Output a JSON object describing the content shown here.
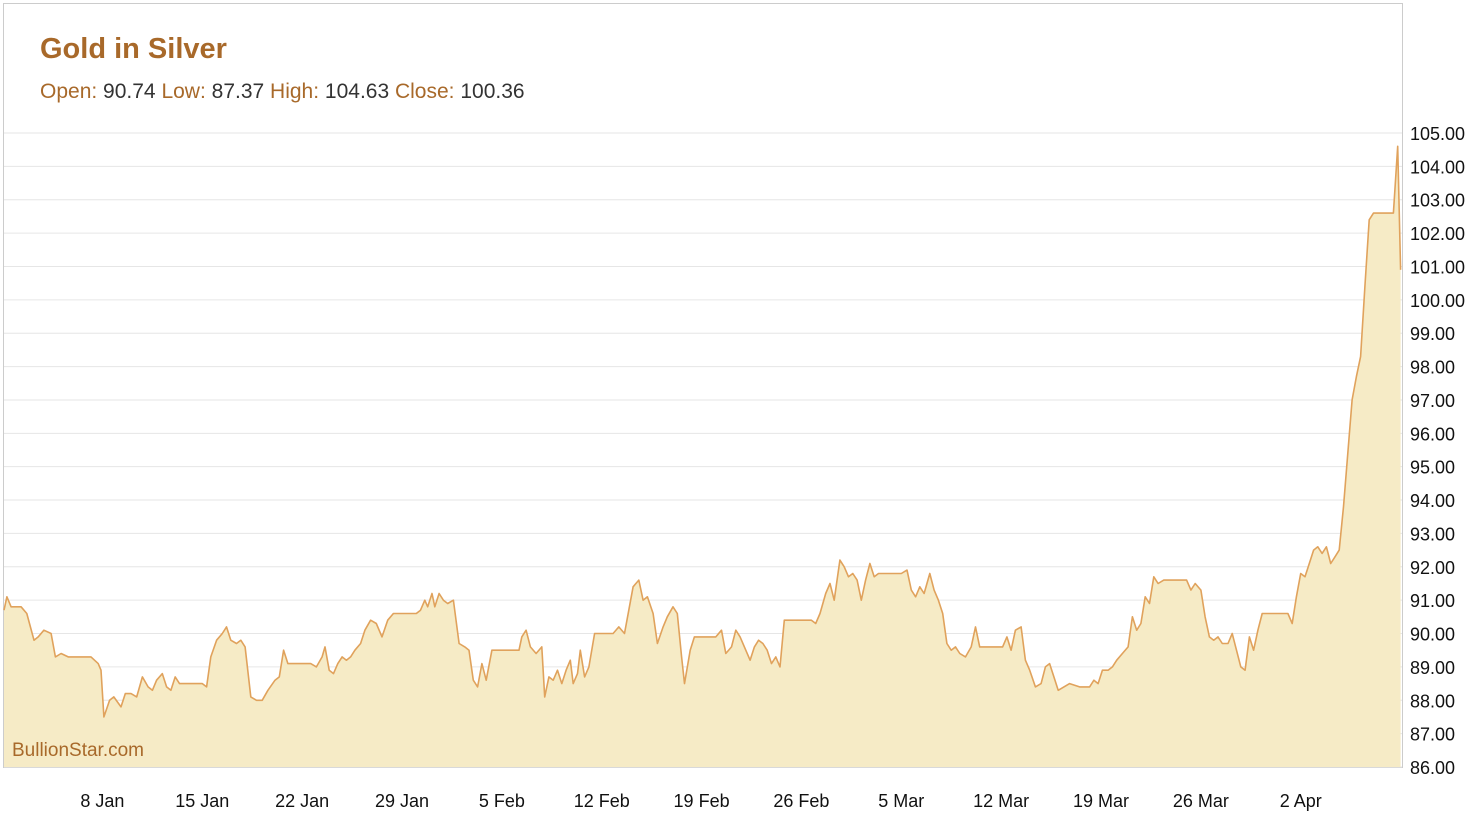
{
  "colors": {
    "accent": "#a8692a",
    "value_text": "#333333",
    "line": "#e0a25c",
    "fill": "#f6ebc6",
    "grid": "#e6e6e6",
    "border": "#cccccc"
  },
  "chart_data": {
    "type": "area",
    "title": "Gold in Silver",
    "stats": [
      {
        "label": "Open:",
        "value": "90.74"
      },
      {
        "label": "Low:",
        "value": "87.37"
      },
      {
        "label": "High:",
        "value": "104.63"
      },
      {
        "label": "Close:",
        "value": "100.36"
      }
    ],
    "watermark": "BullionStar.com",
    "ylim": [
      86,
      105
    ],
    "y_ticks": [
      "105.00",
      "104.00",
      "103.00",
      "102.00",
      "101.00",
      "100.00",
      "99.00",
      "98.00",
      "97.00",
      "96.00",
      "95.00",
      "94.00",
      "93.00",
      "92.00",
      "91.00",
      "90.00",
      "89.00",
      "88.00",
      "87.00",
      "86.00"
    ],
    "x_ticks": [
      {
        "label": "8 Jan",
        "day": 8
      },
      {
        "label": "15 Jan",
        "day": 15
      },
      {
        "label": "22 Jan",
        "day": 22
      },
      {
        "label": "29 Jan",
        "day": 29
      },
      {
        "label": "5 Feb",
        "day": 36
      },
      {
        "label": "12 Feb",
        "day": 43
      },
      {
        "label": "19 Feb",
        "day": 50
      },
      {
        "label": "26 Feb",
        "day": 57
      },
      {
        "label": "5 Mar",
        "day": 64
      },
      {
        "label": "12 Mar",
        "day": 71
      },
      {
        "label": "19 Mar",
        "day": 78
      },
      {
        "label": "26 Mar",
        "day": 85
      },
      {
        "label": "2 Apr",
        "day": 92
      }
    ],
    "xlim": [
      1.1,
      99.1
    ],
    "series": [
      {
        "points": [
          [
            1.1,
            90.7
          ],
          [
            1.3,
            91.1
          ],
          [
            1.6,
            90.8
          ],
          [
            2.3,
            90.8
          ],
          [
            2.7,
            90.6
          ],
          [
            3.2,
            89.8
          ],
          [
            3.5,
            89.9
          ],
          [
            3.9,
            90.1
          ],
          [
            4.4,
            90.0
          ],
          [
            4.7,
            89.3
          ],
          [
            5.1,
            89.4
          ],
          [
            5.6,
            89.3
          ],
          [
            6.5,
            89.3
          ],
          [
            7.2,
            89.3
          ],
          [
            7.7,
            89.1
          ],
          [
            7.9,
            88.9
          ],
          [
            8.1,
            87.5
          ],
          [
            8.5,
            88.0
          ],
          [
            8.8,
            88.1
          ],
          [
            9.3,
            87.8
          ],
          [
            9.6,
            88.2
          ],
          [
            10.0,
            88.2
          ],
          [
            10.4,
            88.1
          ],
          [
            10.8,
            88.7
          ],
          [
            11.2,
            88.4
          ],
          [
            11.5,
            88.3
          ],
          [
            11.8,
            88.6
          ],
          [
            12.2,
            88.8
          ],
          [
            12.5,
            88.4
          ],
          [
            12.8,
            88.3
          ],
          [
            13.1,
            88.7
          ],
          [
            13.4,
            88.5
          ],
          [
            14.2,
            88.5
          ],
          [
            15.0,
            88.5
          ],
          [
            15.3,
            88.4
          ],
          [
            15.6,
            89.3
          ],
          [
            16.0,
            89.8
          ],
          [
            16.4,
            90.0
          ],
          [
            16.7,
            90.2
          ],
          [
            17.0,
            89.8
          ],
          [
            17.4,
            89.7
          ],
          [
            17.7,
            89.8
          ],
          [
            18.0,
            89.6
          ],
          [
            18.4,
            88.1
          ],
          [
            18.8,
            88.0
          ],
          [
            19.2,
            88.0
          ],
          [
            19.6,
            88.3
          ],
          [
            20.1,
            88.6
          ],
          [
            20.4,
            88.7
          ],
          [
            20.7,
            89.5
          ],
          [
            21.0,
            89.1
          ],
          [
            21.3,
            89.1
          ],
          [
            22.3,
            89.1
          ],
          [
            22.6,
            89.1
          ],
          [
            23.0,
            89.0
          ],
          [
            23.4,
            89.3
          ],
          [
            23.6,
            89.6
          ],
          [
            23.9,
            88.9
          ],
          [
            24.2,
            88.8
          ],
          [
            24.5,
            89.1
          ],
          [
            24.8,
            89.3
          ],
          [
            25.1,
            89.2
          ],
          [
            25.4,
            89.3
          ],
          [
            25.7,
            89.5
          ],
          [
            26.1,
            89.7
          ],
          [
            26.4,
            90.1
          ],
          [
            26.8,
            90.4
          ],
          [
            27.2,
            90.3
          ],
          [
            27.6,
            89.9
          ],
          [
            28.0,
            90.4
          ],
          [
            28.4,
            90.6
          ],
          [
            29.3,
            90.6
          ],
          [
            30.0,
            90.6
          ],
          [
            30.3,
            90.7
          ],
          [
            30.6,
            91.0
          ],
          [
            30.8,
            90.8
          ],
          [
            31.1,
            91.2
          ],
          [
            31.3,
            90.8
          ],
          [
            31.6,
            91.2
          ],
          [
            31.9,
            91.0
          ],
          [
            32.2,
            90.9
          ],
          [
            32.6,
            91.0
          ],
          [
            33.0,
            89.7
          ],
          [
            33.4,
            89.6
          ],
          [
            33.7,
            89.5
          ],
          [
            34.0,
            88.6
          ],
          [
            34.3,
            88.4
          ],
          [
            34.6,
            89.1
          ],
          [
            34.9,
            88.6
          ],
          [
            35.3,
            89.5
          ],
          [
            36.0,
            89.5
          ],
          [
            36.8,
            89.5
          ],
          [
            37.2,
            89.5
          ],
          [
            37.4,
            89.9
          ],
          [
            37.7,
            90.1
          ],
          [
            38.0,
            89.6
          ],
          [
            38.4,
            89.4
          ],
          [
            38.8,
            89.6
          ],
          [
            39.0,
            88.1
          ],
          [
            39.3,
            88.7
          ],
          [
            39.6,
            88.6
          ],
          [
            39.9,
            88.9
          ],
          [
            40.2,
            88.5
          ],
          [
            40.5,
            88.9
          ],
          [
            40.8,
            89.2
          ],
          [
            41.0,
            88.5
          ],
          [
            41.3,
            88.8
          ],
          [
            41.5,
            89.5
          ],
          [
            41.8,
            88.7
          ],
          [
            42.1,
            89.0
          ],
          [
            42.5,
            90.0
          ],
          [
            43.0,
            90.0
          ],
          [
            43.8,
            90.0
          ],
          [
            44.2,
            90.2
          ],
          [
            44.6,
            90.0
          ],
          [
            44.9,
            90.7
          ],
          [
            45.2,
            91.4
          ],
          [
            45.6,
            91.6
          ],
          [
            45.9,
            91.0
          ],
          [
            46.2,
            91.1
          ],
          [
            46.6,
            90.6
          ],
          [
            46.9,
            89.7
          ],
          [
            47.3,
            90.2
          ],
          [
            47.6,
            90.5
          ],
          [
            48.0,
            90.8
          ],
          [
            48.3,
            90.6
          ],
          [
            48.6,
            89.3
          ],
          [
            48.8,
            88.5
          ],
          [
            49.2,
            89.5
          ],
          [
            49.5,
            89.9
          ],
          [
            50.3,
            89.9
          ],
          [
            51.0,
            89.9
          ],
          [
            51.4,
            90.1
          ],
          [
            51.7,
            89.4
          ],
          [
            52.1,
            89.6
          ],
          [
            52.4,
            90.1
          ],
          [
            52.7,
            89.9
          ],
          [
            53.0,
            89.6
          ],
          [
            53.4,
            89.2
          ],
          [
            53.7,
            89.6
          ],
          [
            54.0,
            89.8
          ],
          [
            54.3,
            89.7
          ],
          [
            54.6,
            89.5
          ],
          [
            54.9,
            89.1
          ],
          [
            55.2,
            89.3
          ],
          [
            55.5,
            89.0
          ],
          [
            55.8,
            90.4
          ],
          [
            56.2,
            90.4
          ],
          [
            57.0,
            90.4
          ],
          [
            57.7,
            90.4
          ],
          [
            58.0,
            90.3
          ],
          [
            58.3,
            90.6
          ],
          [
            58.7,
            91.2
          ],
          [
            59.0,
            91.5
          ],
          [
            59.3,
            91.0
          ],
          [
            59.7,
            92.2
          ],
          [
            60.0,
            92.0
          ],
          [
            60.3,
            91.7
          ],
          [
            60.6,
            91.8
          ],
          [
            60.9,
            91.6
          ],
          [
            61.2,
            91.0
          ],
          [
            61.5,
            91.6
          ],
          [
            61.8,
            92.1
          ],
          [
            62.1,
            91.7
          ],
          [
            62.4,
            91.8
          ],
          [
            63.2,
            91.8
          ],
          [
            64.0,
            91.8
          ],
          [
            64.4,
            91.9
          ],
          [
            64.7,
            91.3
          ],
          [
            65.0,
            91.1
          ],
          [
            65.3,
            91.4
          ],
          [
            65.6,
            91.2
          ],
          [
            66.0,
            91.8
          ],
          [
            66.3,
            91.3
          ],
          [
            66.6,
            91.0
          ],
          [
            66.9,
            90.6
          ],
          [
            67.2,
            89.7
          ],
          [
            67.5,
            89.5
          ],
          [
            67.8,
            89.6
          ],
          [
            68.1,
            89.4
          ],
          [
            68.5,
            89.3
          ],
          [
            68.9,
            89.6
          ],
          [
            69.2,
            90.2
          ],
          [
            69.5,
            89.6
          ],
          [
            70.3,
            89.6
          ],
          [
            71.1,
            89.6
          ],
          [
            71.4,
            89.9
          ],
          [
            71.7,
            89.5
          ],
          [
            72.0,
            90.1
          ],
          [
            72.4,
            90.2
          ],
          [
            72.7,
            89.2
          ],
          [
            73.0,
            88.9
          ],
          [
            73.4,
            88.4
          ],
          [
            73.8,
            88.5
          ],
          [
            74.1,
            89.0
          ],
          [
            74.4,
            89.1
          ],
          [
            74.7,
            88.7
          ],
          [
            75.0,
            88.3
          ],
          [
            75.4,
            88.4
          ],
          [
            75.8,
            88.5
          ],
          [
            76.5,
            88.4
          ],
          [
            77.2,
            88.4
          ],
          [
            77.5,
            88.6
          ],
          [
            77.8,
            88.5
          ],
          [
            78.1,
            88.9
          ],
          [
            78.5,
            88.9
          ],
          [
            78.8,
            89.0
          ],
          [
            79.1,
            89.2
          ],
          [
            79.5,
            89.4
          ],
          [
            79.9,
            89.6
          ],
          [
            80.2,
            90.5
          ],
          [
            80.5,
            90.1
          ],
          [
            80.8,
            90.3
          ],
          [
            81.1,
            91.1
          ],
          [
            81.4,
            90.9
          ],
          [
            81.7,
            91.7
          ],
          [
            82.0,
            91.5
          ],
          [
            82.4,
            91.6
          ],
          [
            83.0,
            91.6
          ],
          [
            83.7,
            91.6
          ],
          [
            84.0,
            91.6
          ],
          [
            84.3,
            91.3
          ],
          [
            84.6,
            91.5
          ],
          [
            85.0,
            91.3
          ],
          [
            85.3,
            90.5
          ],
          [
            85.6,
            89.9
          ],
          [
            85.9,
            89.8
          ],
          [
            86.2,
            89.9
          ],
          [
            86.5,
            89.7
          ],
          [
            86.9,
            89.7
          ],
          [
            87.2,
            90.0
          ],
          [
            87.5,
            89.5
          ],
          [
            87.8,
            89.0
          ],
          [
            88.1,
            88.9
          ],
          [
            88.4,
            89.9
          ],
          [
            88.7,
            89.5
          ],
          [
            89.0,
            90.1
          ],
          [
            89.3,
            90.6
          ],
          [
            90.0,
            90.6
          ],
          [
            90.8,
            90.6
          ],
          [
            91.1,
            90.6
          ],
          [
            91.4,
            90.3
          ],
          [
            91.7,
            91.1
          ],
          [
            92.0,
            91.8
          ],
          [
            92.3,
            91.7
          ],
          [
            92.6,
            92.1
          ],
          [
            92.9,
            92.5
          ],
          [
            93.2,
            92.6
          ],
          [
            93.5,
            92.4
          ],
          [
            93.8,
            92.6
          ],
          [
            94.1,
            92.1
          ],
          [
            94.4,
            92.3
          ],
          [
            94.7,
            92.5
          ],
          [
            95.0,
            93.8
          ],
          [
            95.3,
            95.4
          ],
          [
            95.6,
            97.0
          ],
          [
            95.9,
            97.7
          ],
          [
            96.2,
            98.3
          ],
          [
            96.5,
            100.4
          ],
          [
            96.8,
            102.4
          ],
          [
            97.1,
            102.6
          ],
          [
            97.4,
            102.6
          ],
          [
            98.0,
            102.6
          ],
          [
            98.5,
            102.6
          ],
          [
            98.8,
            104.6
          ],
          [
            99.0,
            100.9
          ]
        ]
      }
    ]
  }
}
